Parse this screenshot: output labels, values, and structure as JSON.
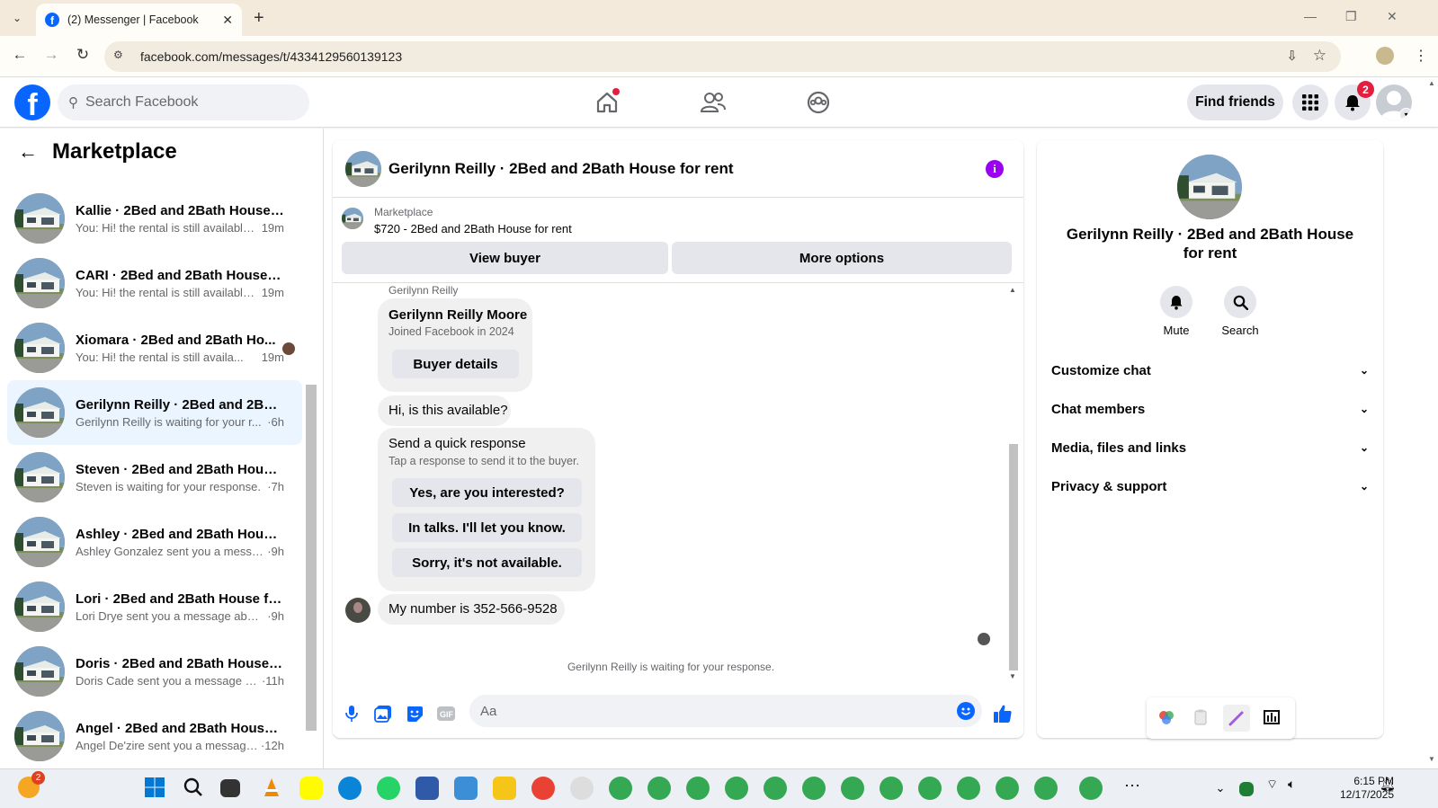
{
  "browser": {
    "tab_title": "(2) Messenger | Facebook",
    "favicon": "f",
    "url": "facebook.com/messages/t/4334129560139123"
  },
  "header": {
    "search_placeholder": "Search Facebook",
    "find_friends": "Find friends",
    "notif_count": "2",
    "nav_icons": [
      "home-icon",
      "friends-icon",
      "groups-icon"
    ],
    "brand_color": "#0866ff"
  },
  "sidebar": {
    "title": "Marketplace",
    "conversations": [
      {
        "name": "Kallie · 2Bed and 2Bath House f...",
        "snippet": "You: Hi! the rental is still available...",
        "time": "19m"
      },
      {
        "name": "CARI · 2Bed and 2Bath House fo...",
        "snippet": "You: Hi! the rental is still available...",
        "time": "19m"
      },
      {
        "name": "Xiomara · 2Bed and 2Bath Ho...",
        "snippet": "You: Hi! the rental is still availa...",
        "time": "19m"
      },
      {
        "name": "Gerilynn Reilly · 2Bed and 2Bath...",
        "snippet": "Gerilynn Reilly is waiting for your r...",
        "time": "·6h"
      },
      {
        "name": "Steven · 2Bed and 2Bath House ...",
        "snippet": "Steven is waiting for your response.",
        "time": "·7h"
      },
      {
        "name": "Ashley · 2Bed and 2Bath House ...",
        "snippet": "Ashley Gonzalez sent you a messa...",
        "time": "·9h"
      },
      {
        "name": "Lori · 2Bed and 2Bath House for...",
        "snippet": "Lori Drye sent you a message abou...",
        "time": "·9h"
      },
      {
        "name": "Doris · 2Bed and 2Bath House f...",
        "snippet": "Doris Cade sent you a message a...",
        "time": "·11h"
      },
      {
        "name": "Angel · 2Bed and 2Bath House f...",
        "snippet": "Angel De'zire sent you a message...",
        "time": "·12h"
      }
    ]
  },
  "chat": {
    "title": "Gerilynn Reilly · 2Bed and 2Bath House for rent",
    "marketplace_label": "Marketplace",
    "listing": "$720 - 2Bed and 2Bath House for rent",
    "view_buyer": "View buyer",
    "more_options": "More options",
    "sender_label": "Gerilynn Reilly",
    "buyer_card": {
      "name": "Gerilynn Reilly Moore",
      "joined": "Joined Facebook in 2024",
      "button": "Buyer details"
    },
    "msg1": "Hi, is this available?",
    "quick": {
      "title": "Send a quick response",
      "subtitle": "Tap a response to send it to the buyer.",
      "options": [
        "Yes, are you interested?",
        "In talks. I'll let you know.",
        "Sorry, it's not available."
      ]
    },
    "msg2": "My number is 352-566-9528",
    "waiting": "Gerilynn Reilly is waiting for your response.",
    "composer_placeholder": "Aa"
  },
  "info": {
    "name": "Gerilynn Reilly · 2Bed and 2Bath House for rent",
    "mute": "Mute",
    "search": "Search",
    "sections": [
      "Customize chat",
      "Chat members",
      "Media, files and links",
      "Privacy & support"
    ]
  },
  "taskbar": {
    "time": "6:15 PM",
    "date": "12/17/2025",
    "weather_badge": "2"
  }
}
